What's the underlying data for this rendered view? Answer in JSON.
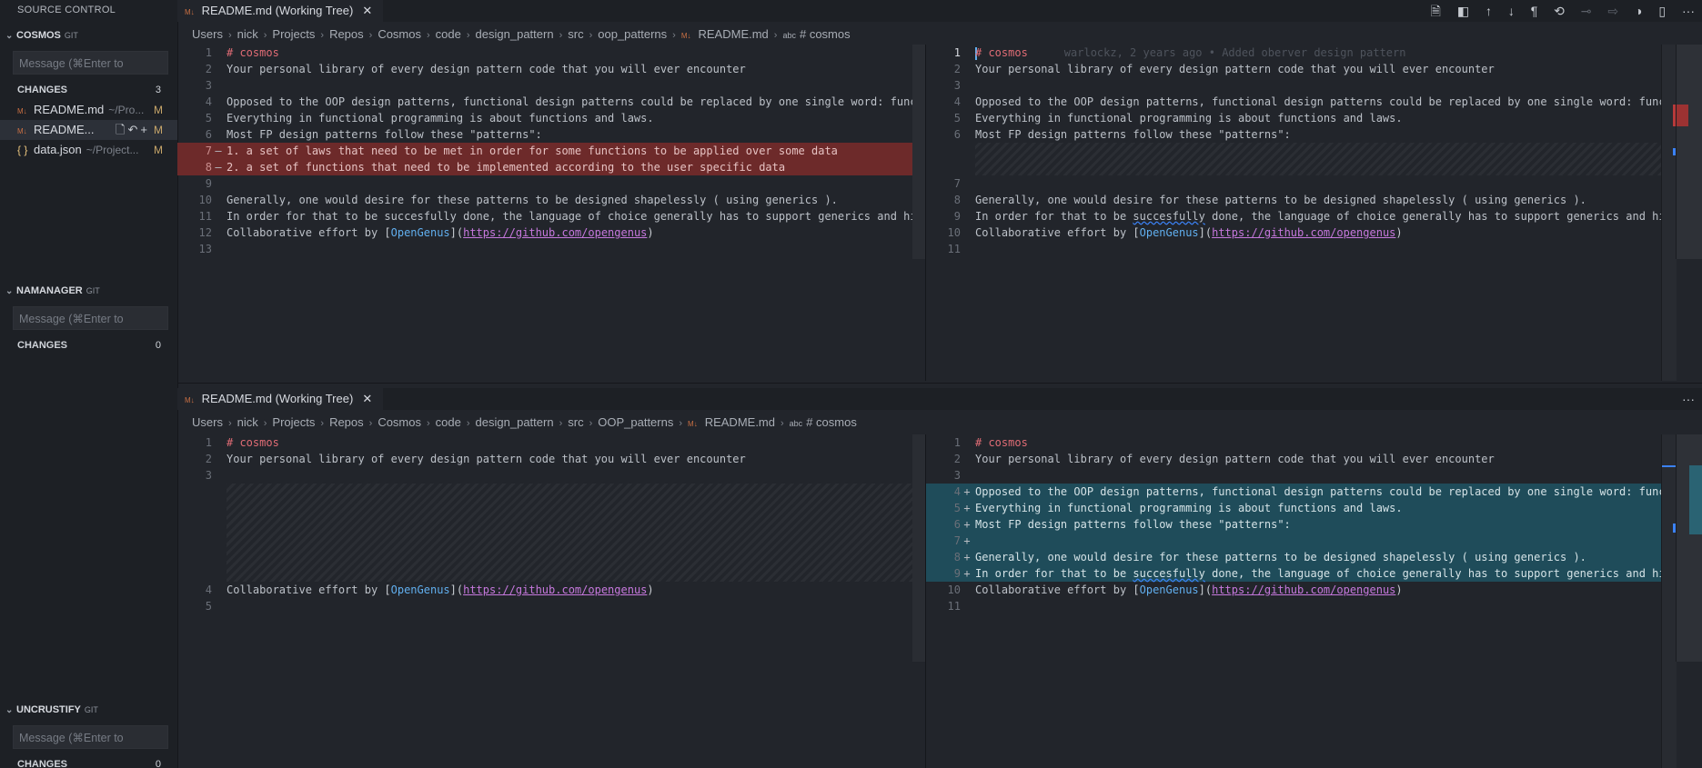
{
  "sidebar": {
    "title": "SOURCE CONTROL",
    "repos": [
      {
        "name": "COSMOS",
        "tag": "GIT",
        "message_placeholder": "Message (⌘Enter to",
        "changes_label": "CHANGES",
        "changes_count": "3",
        "files": [
          {
            "name": "README.md",
            "path": "~/Pro...",
            "status": "M"
          },
          {
            "name": "README...",
            "path": "",
            "status": "M"
          },
          {
            "name": "data.json",
            "path": "~/Project...",
            "status": "M"
          }
        ]
      },
      {
        "name": "NAMANAGER",
        "tag": "GIT",
        "message_placeholder": "Message (⌘Enter to",
        "changes_label": "CHANGES",
        "changes_count": "0"
      },
      {
        "name": "UNCRUSTIFY",
        "tag": "GIT",
        "message_placeholder": "Message (⌘Enter to",
        "changes_label": "CHANGES",
        "changes_count": "0"
      }
    ]
  },
  "top_group": {
    "tab_title": "README.md (Working Tree)",
    "breadcrumbs": [
      "Users",
      "nick",
      "Projects",
      "Repos",
      "Cosmos",
      "code",
      "design_pattern",
      "src",
      "oop_patterns",
      "README.md",
      "# cosmos"
    ]
  },
  "bottom_group": {
    "tab_title": "README.md (Working Tree)",
    "breadcrumbs": [
      "Users",
      "nick",
      "Projects",
      "Repos",
      "Cosmos",
      "code",
      "design_pattern",
      "src",
      "OOP_patterns",
      "README.md",
      "# cosmos"
    ]
  },
  "text": {
    "heading": "# cosmos",
    "tagline": "Your personal library of every design pattern code that you will ever encounter",
    "opposed": "Opposed to the OOP design patterns, functional design patterns could be replaced by one single word: functi",
    "everything": "Everything in functional programming is about functions and laws.",
    "most_fp": "Most FP design patterns follow these \"patterns\":",
    "laws": "1. a set of laws that need to be met in order for some functions to be applied over some data",
    "funcs": "2. a set of functions that need to be implemented according to the user specific data",
    "generally": "Generally, one would desire for these patterns to be designed shapelessly ( using generics ).",
    "in_order_a": "In order for that to be ",
    "succesfully": "succesfully",
    "in_order_b": " done, the language of choice generally has to support generics and high",
    "collab": "Collaborative effort by ",
    "link_text": "OpenGenus",
    "url": "https://github.com/opengenus",
    "blame": "warlockz, 2 years ago • Added oberver design pattern"
  },
  "gutter_marks": {
    "deleted": "—",
    "added": "+"
  },
  "actions": {
    "more": "···"
  }
}
